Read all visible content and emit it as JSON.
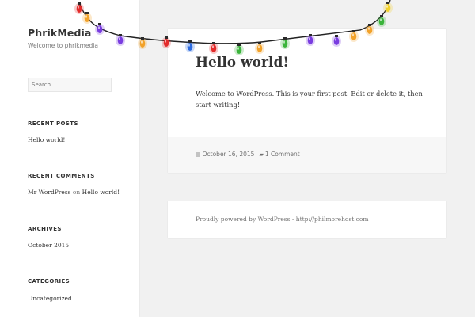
{
  "site": {
    "title": "PhrikMedia",
    "description": "Welcome to phrikmedia"
  },
  "search": {
    "placeholder": "Search …"
  },
  "widgets": {
    "recent_posts": {
      "title": "RECENT POSTS",
      "items": [
        "Hello world!"
      ]
    },
    "recent_comments": {
      "title": "RECENT COMMENTS",
      "author": "Mr WordPress",
      "on": "on",
      "post": "Hello world!"
    },
    "archives": {
      "title": "ARCHIVES",
      "items": [
        "October 2015"
      ]
    },
    "categories": {
      "title": "CATEGORIES",
      "items": [
        "Uncategorized"
      ]
    }
  },
  "post": {
    "title": "Hello world!",
    "body": "Welcome to WordPress. This is your first post. Edit or delete it, then start writing!",
    "date": "October 16, 2015",
    "comments": "1 Comment",
    "date_icon": "calendar-icon",
    "comment_icon": "comment-icon"
  },
  "footer": {
    "text": "Proudly powered by WordPress - http://philmorehost.com"
  },
  "decoration": {
    "type": "christmas-lights",
    "bulb_colors": [
      "#e32b2b",
      "#f2a22a",
      "#3bb43b",
      "#7a3de0",
      "#2d6be0",
      "#f2d12a"
    ]
  },
  "colors": {
    "page_bg": "#f1f1f1",
    "sidebar_bg": "#ffffff",
    "card_bg": "#ffffff",
    "text": "#333333",
    "muted": "#707070"
  }
}
